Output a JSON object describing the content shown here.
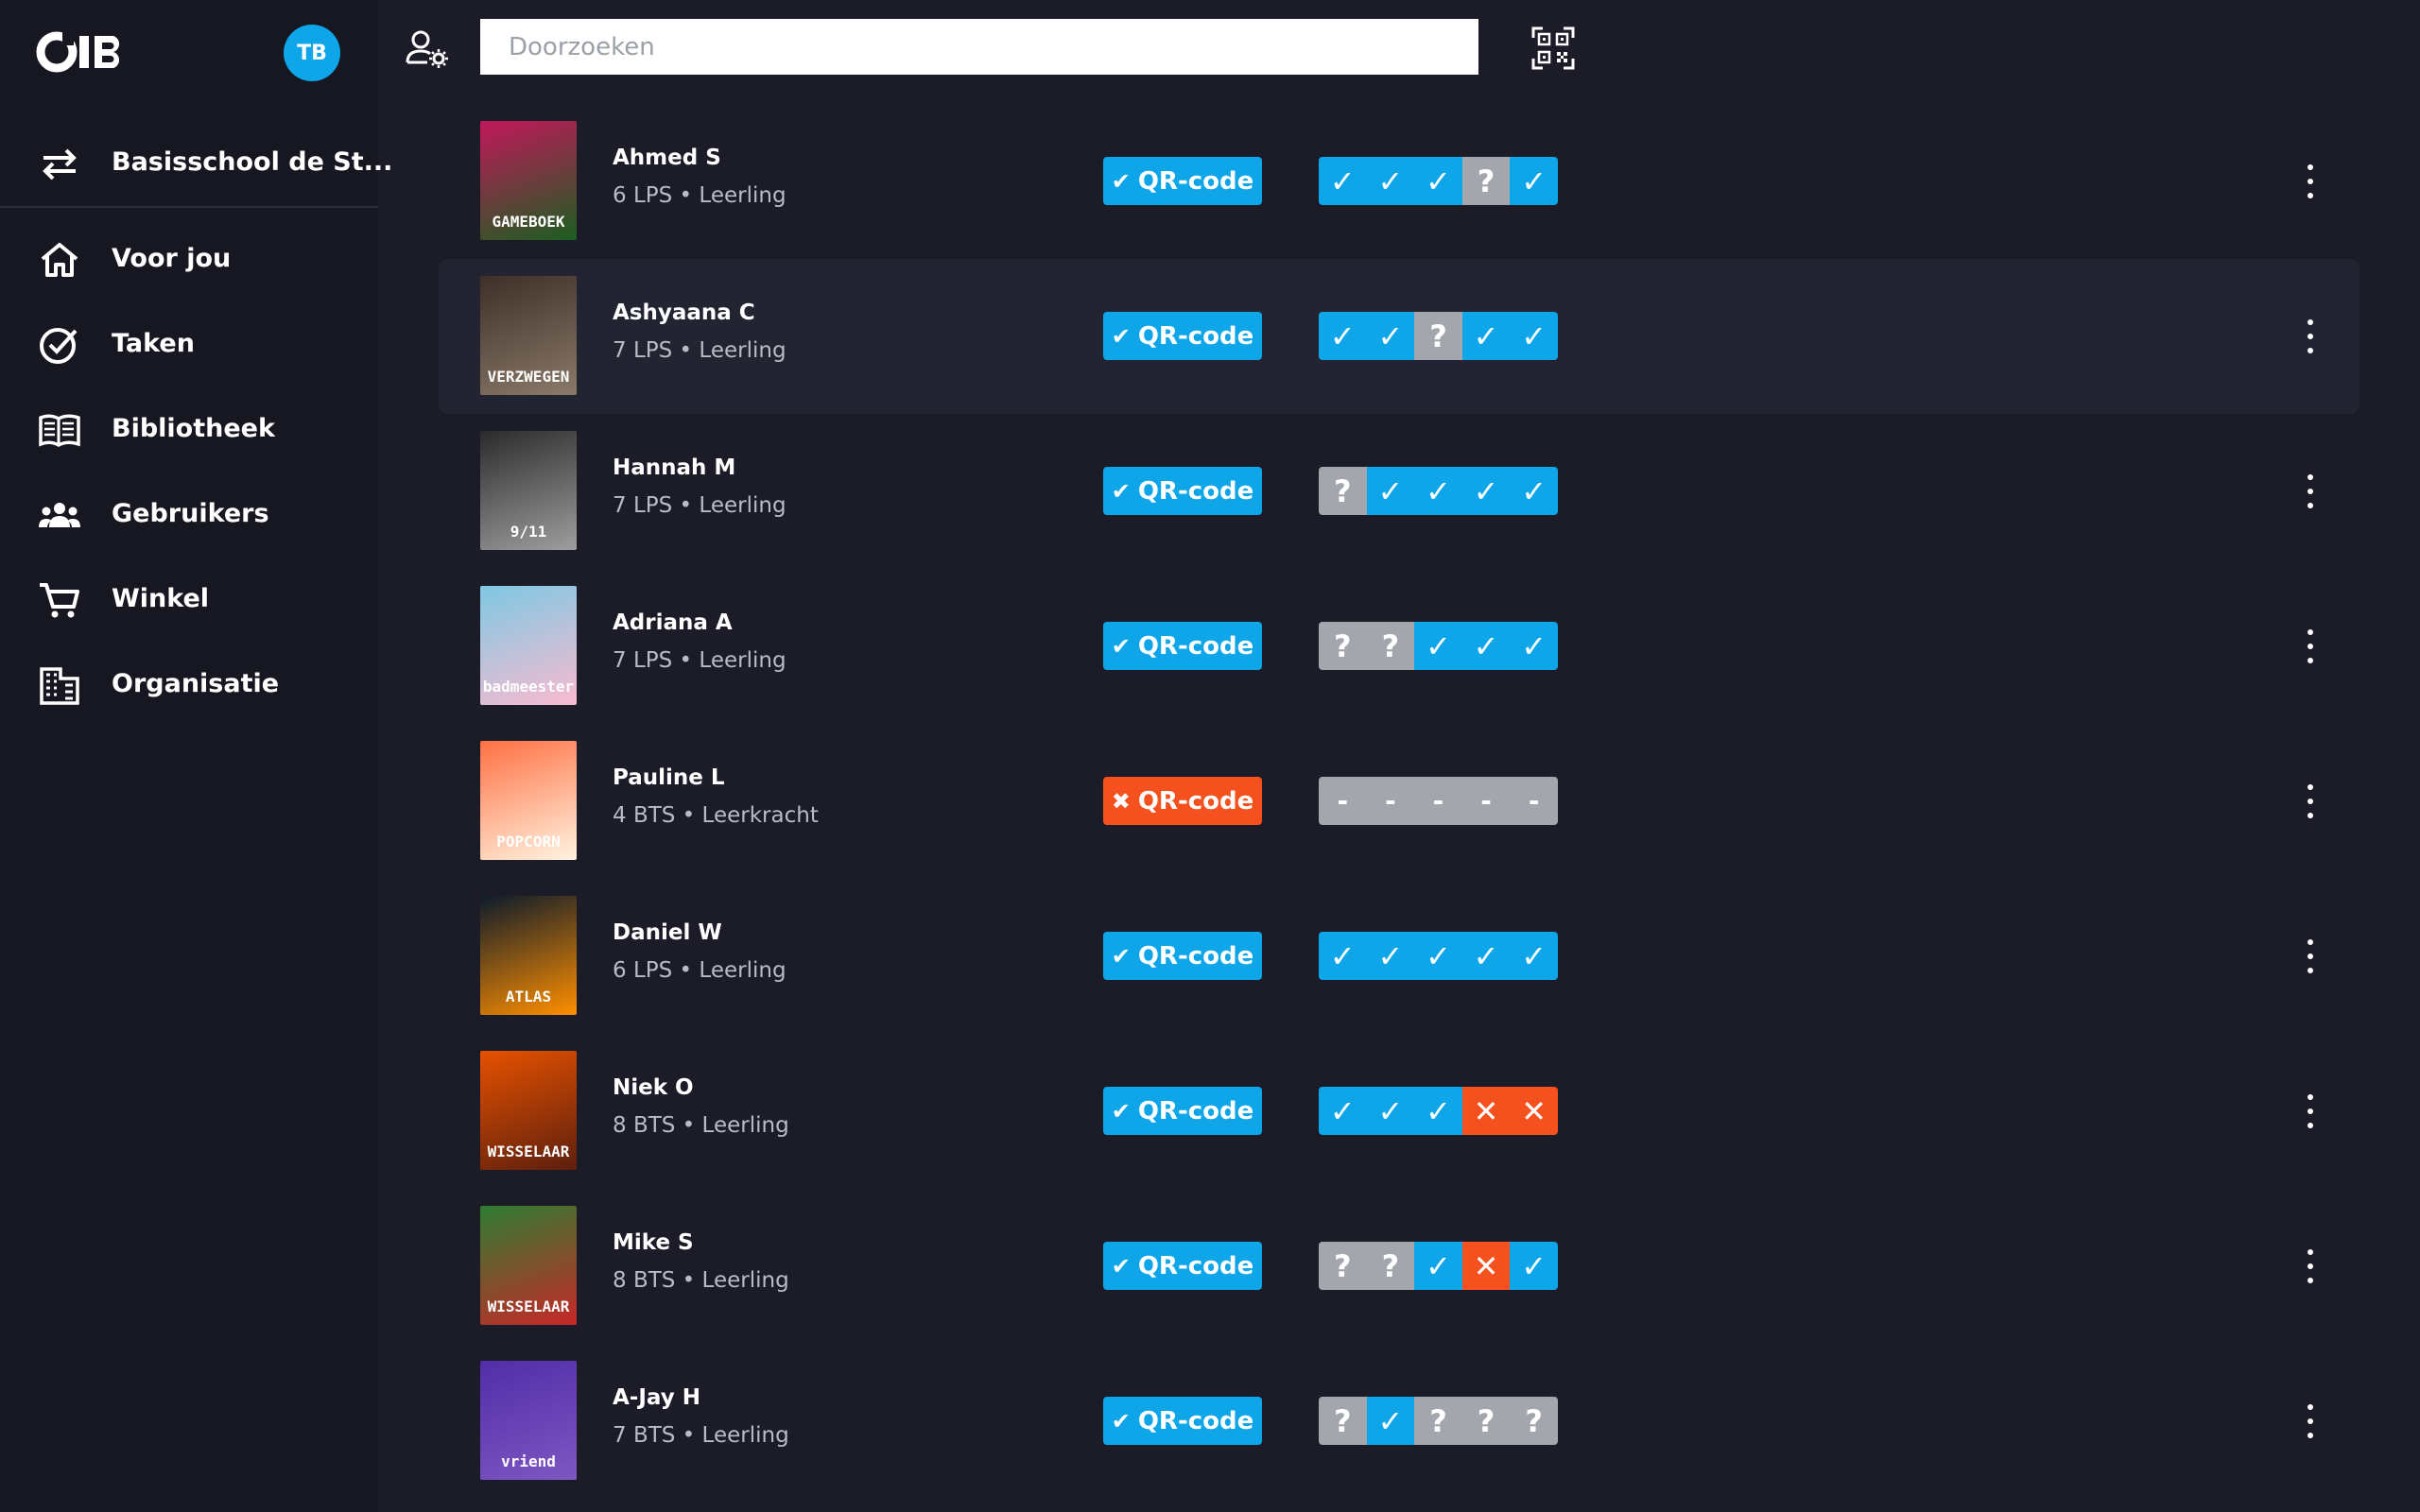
{
  "brand": {
    "logo_text": "OIB"
  },
  "user": {
    "initials": "TB"
  },
  "sidebar": {
    "school": "Basisschool de St...",
    "items": [
      {
        "label": "Voor jou",
        "icon": "home-icon"
      },
      {
        "label": "Taken",
        "icon": "check-circle-icon"
      },
      {
        "label": "Bibliotheek",
        "icon": "book-icon"
      },
      {
        "label": "Gebruikers",
        "icon": "users-icon"
      },
      {
        "label": "Winkel",
        "icon": "cart-icon"
      },
      {
        "label": "Organisatie",
        "icon": "building-icon"
      }
    ]
  },
  "search": {
    "placeholder": "Doorzoeken"
  },
  "colors": {
    "accent": "#0ea5e9",
    "error": "#f4511e",
    "unknown": "#a3a6ad"
  },
  "rows": [
    {
      "name": "Ahmed S",
      "meta": "6 LPS • Leerling",
      "qr_label": "QR-code",
      "qr_ok": true,
      "status": [
        "check",
        "check",
        "check",
        "question",
        "check"
      ],
      "cover_text": "GAMEBOEK",
      "cover_colors": [
        "#c2185b",
        "#1b5e20"
      ]
    },
    {
      "name": "Ashyaana C",
      "meta": "7 LPS • Leerling",
      "qr_label": "QR-code",
      "qr_ok": true,
      "status": [
        "check",
        "check",
        "question",
        "check",
        "check"
      ],
      "cover_text": "VERZWEGEN",
      "cover_colors": [
        "#3e2f28",
        "#8a7a6a"
      ]
    },
    {
      "name": "Hannah M",
      "meta": "7 LPS • Leerling",
      "qr_label": "QR-code",
      "qr_ok": true,
      "status": [
        "question",
        "check",
        "check",
        "check",
        "check"
      ],
      "cover_text": "9/11",
      "cover_colors": [
        "#2b2b2b",
        "#9e9e9e"
      ]
    },
    {
      "name": "Adriana A",
      "meta": "7 LPS • Leerling",
      "qr_label": "QR-code",
      "qr_ok": true,
      "status": [
        "question",
        "question",
        "check",
        "check",
        "check"
      ],
      "cover_text": "badmeester",
      "cover_colors": [
        "#7ec8e3",
        "#f8bbd0"
      ]
    },
    {
      "name": "Pauline L",
      "meta": "4 BTS • Leerkracht",
      "qr_label": "QR-code",
      "qr_ok": false,
      "status": [
        "dash",
        "dash",
        "dash",
        "dash",
        "dash"
      ],
      "cover_text": "POPCORN",
      "cover_colors": [
        "#ff7043",
        "#fff3e0"
      ]
    },
    {
      "name": "Daniel W",
      "meta": "6 LPS • Leerling",
      "qr_label": "QR-code",
      "qr_ok": true,
      "status": [
        "check",
        "check",
        "check",
        "check",
        "check"
      ],
      "cover_text": "ATLAS",
      "cover_colors": [
        "#0d1b2a",
        "#ff8f00"
      ]
    },
    {
      "name": "Niek O",
      "meta": "8 BTS • Leerling",
      "qr_label": "QR-code",
      "qr_ok": true,
      "status": [
        "check",
        "check",
        "check",
        "cross",
        "cross"
      ],
      "cover_text": "WISSELAAR",
      "cover_colors": [
        "#e65100",
        "#5d1f0e"
      ]
    },
    {
      "name": "Mike S",
      "meta": "8 BTS • Leerling",
      "qr_label": "QR-code",
      "qr_ok": true,
      "status": [
        "question",
        "question",
        "check",
        "cross",
        "check"
      ],
      "cover_text": "WISSELAAR",
      "cover_colors": [
        "#2e7d32",
        "#c62828"
      ]
    },
    {
      "name": "A-Jay H",
      "meta": "7 BTS • Leerling",
      "qr_label": "QR-code",
      "qr_ok": true,
      "status": [
        "question",
        "check",
        "question",
        "question",
        "question"
      ],
      "cover_text": "vriend",
      "cover_colors": [
        "#512da8",
        "#7e57c2"
      ]
    }
  ],
  "highlighted_row": 1
}
